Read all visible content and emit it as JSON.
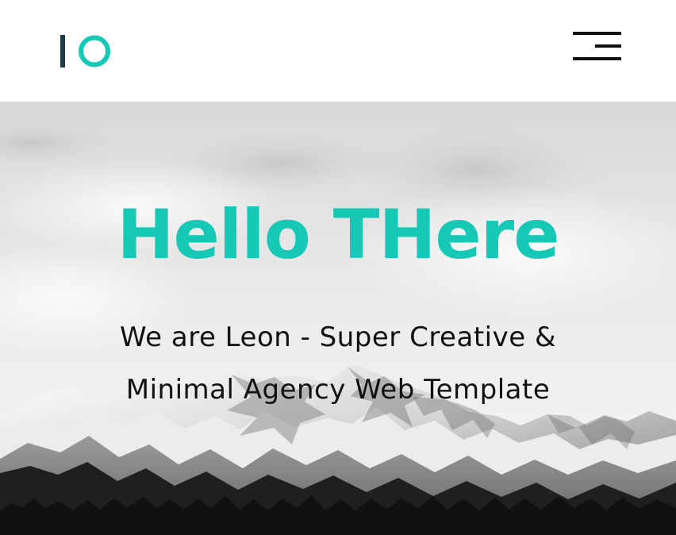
{
  "header": {
    "logo_icon": "io-logo-icon",
    "menu_icon": "hamburger-menu-icon"
  },
  "hero": {
    "title": "Hello THere",
    "subtitle": "We are Leon - Super Creative & Minimal Agency Web Template",
    "background": "mountain-landscape-image"
  },
  "colors": {
    "accent": "#16c9b6",
    "logo_dark": "#1c3b45",
    "text": "#111111",
    "header_bg": "#ffffff"
  }
}
